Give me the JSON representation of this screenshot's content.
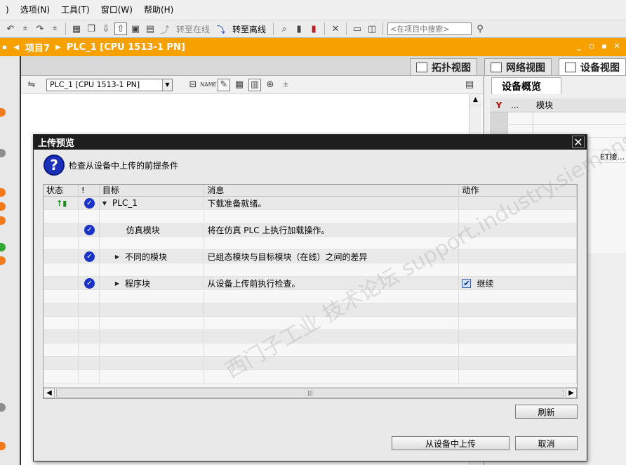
{
  "menubar": {
    "items": [
      ")",
      "选项(N)",
      "工具(T)",
      "窗口(W)",
      "帮助(H)"
    ]
  },
  "toolbar": {
    "go_online": "转至在线",
    "go_offline": "转至离线",
    "search_placeholder": "<在项目中搜索>"
  },
  "breadcrumb": {
    "project": "项目7",
    "device": "PLC_1 [CPU 1513-1 PN]"
  },
  "view_tabs": {
    "topology": "拓扑视图",
    "network": "网络视图",
    "device": "设备视图"
  },
  "editor": {
    "device_select": "PLC_1 [CPU 1513-1 PN]"
  },
  "overview": {
    "tab": "设备概览",
    "col_dots": "...",
    "col_module": "模块",
    "snippet": "ET接..."
  },
  "dialog": {
    "title": "上传预览",
    "header": "检查从设备中上传的前提条件",
    "columns": {
      "status": "状态",
      "bang": "!",
      "target": "目标",
      "message": "消息",
      "action": "动作"
    },
    "rows": [
      {
        "target": "PLC_1",
        "message": "下载准备就绪。",
        "action": ""
      },
      {
        "target": "仿真模块",
        "message": "将在仿真 PLC 上执行加载操作。",
        "action": ""
      },
      {
        "target": "不同的模块",
        "message": "已组态模块与目标模块（在线）之间的差异",
        "action": ""
      },
      {
        "target": "程序块",
        "message": "从设备上传前执行检查。",
        "action": "继续"
      }
    ],
    "refresh": "刷新",
    "upload": "从设备中上传",
    "cancel": "取消"
  },
  "watermark": "西门子工业 技术论坛 support.industry.siemens.com/cs",
  "colors": {
    "accent": "#f7a100",
    "dialog_title": "#1e1e1e",
    "check": "#1a33c4"
  }
}
